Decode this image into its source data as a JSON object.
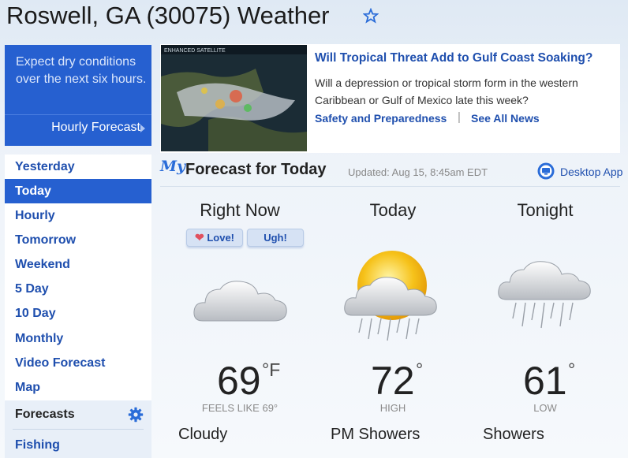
{
  "header": {
    "title": "Roswell, GA (30075) Weather",
    "favorite_icon": "star-outline-icon"
  },
  "promo": {
    "text": "Expect dry conditions over the next six hours.",
    "link": "Hourly Forecast",
    "bg": "#2660d0"
  },
  "nav": {
    "items": [
      {
        "label": "Yesterday",
        "active": false
      },
      {
        "label": "Today",
        "active": true
      },
      {
        "label": "Hourly",
        "active": false
      },
      {
        "label": "Tomorrow",
        "active": false
      },
      {
        "label": "Weekend",
        "active": false
      },
      {
        "label": "5 Day",
        "active": false
      },
      {
        "label": "10 Day",
        "active": false
      },
      {
        "label": "Monthly",
        "active": false
      },
      {
        "label": "Video Forecast",
        "active": false
      },
      {
        "label": "Map",
        "active": false
      }
    ],
    "forecasts_label": "Forecasts",
    "forecasts_icon": "gear-icon",
    "fishing_label": "Fishing"
  },
  "news": {
    "image_caption": "ENHANCED SATELLITE",
    "headline": "Will Tropical Threat Add to Gulf Coast Soaking?",
    "body": "Will a depression or tropical storm form in the western Caribbean or Gulf of Mexico late this week?",
    "link1": "Safety and Preparedness",
    "link2": "See All News"
  },
  "forecast": {
    "my_logo": "My",
    "title": "Forecast for Today",
    "updated": "Updated: Aug 15, 8:45am EDT",
    "desktop_app": "Desktop App",
    "columns": [
      {
        "head": "Right Now",
        "temp": "69",
        "unit": "°F",
        "sub": "FEELS LIKE 69°",
        "condition": "Cloudy",
        "icon": "cloudy-icon"
      },
      {
        "head": "Today",
        "temp": "72",
        "unit": "°",
        "sub": "HIGH",
        "condition": "PM Showers",
        "icon": "sun-showers-icon"
      },
      {
        "head": "Tonight",
        "temp": "61",
        "unit": "°",
        "sub": "LOW",
        "condition": "Showers",
        "icon": "showers-icon"
      }
    ],
    "love_label": "Love!",
    "ugh_label": "Ugh!"
  }
}
